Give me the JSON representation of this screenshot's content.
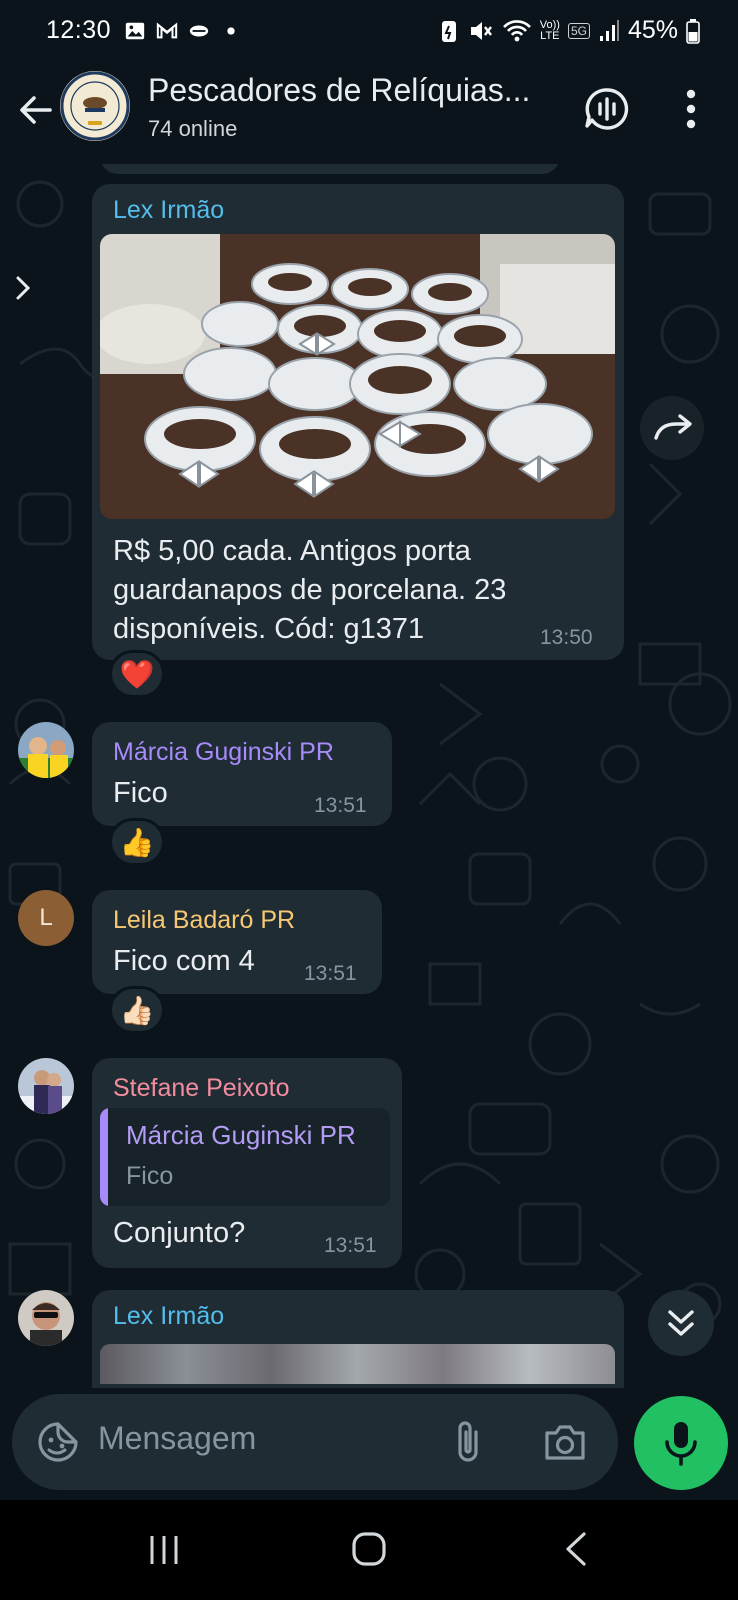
{
  "status_bar": {
    "time": "12:30",
    "battery": "45%",
    "network_small_top": "Vo))",
    "network_small_bottom": "LTE",
    "network_gen": "5G"
  },
  "header": {
    "title": "Pescadores de Relíquias...",
    "subtitle": "74 online",
    "avatar_text_top": "PESCADORES",
    "avatar_text_mid": "DE",
    "avatar_text_bottom": "RELÍQUIAS"
  },
  "messages": [
    {
      "sender": "Lex Irmão",
      "sender_color": "#53bdeb",
      "text_lines": [
        "R$ 5,00 cada. Antigos porta",
        "guardanapos de porcelana. 23",
        "disponíveis.  Cód: g1371"
      ],
      "time": "13:50",
      "reaction": "❤️"
    },
    {
      "sender": "Márcia Guginski PR",
      "sender_color": "#a78bfa",
      "text": "Fico",
      "time": "13:51",
      "reaction": "👍"
    },
    {
      "sender": "Leila Badaró PR",
      "sender_color": "#f7c873",
      "avatar_letter": "L",
      "text": "Fico com 4",
      "time": "13:51",
      "reaction": "👍🏻"
    },
    {
      "sender": "Stefane Peixoto",
      "sender_color": "#f38c9f",
      "quote_name": "Márcia Guginski PR",
      "quote_text": "Fico",
      "text": "Conjunto?",
      "time": "13:51"
    },
    {
      "sender": "Lex Irmão",
      "sender_color": "#53bdeb"
    }
  ],
  "composer": {
    "placeholder": "Mensagem"
  },
  "colors": {
    "background": "#0b141a",
    "bubble": "#1f2c34",
    "accent_green": "#21c063",
    "timestamp": "#8696a0"
  },
  "icons": [
    "back-arrow-icon",
    "voice-chat-icon",
    "more-vert-icon",
    "forward-icon",
    "chevrons-down-icon",
    "sticker-icon",
    "paperclip-icon",
    "camera-icon",
    "microphone-icon"
  ]
}
